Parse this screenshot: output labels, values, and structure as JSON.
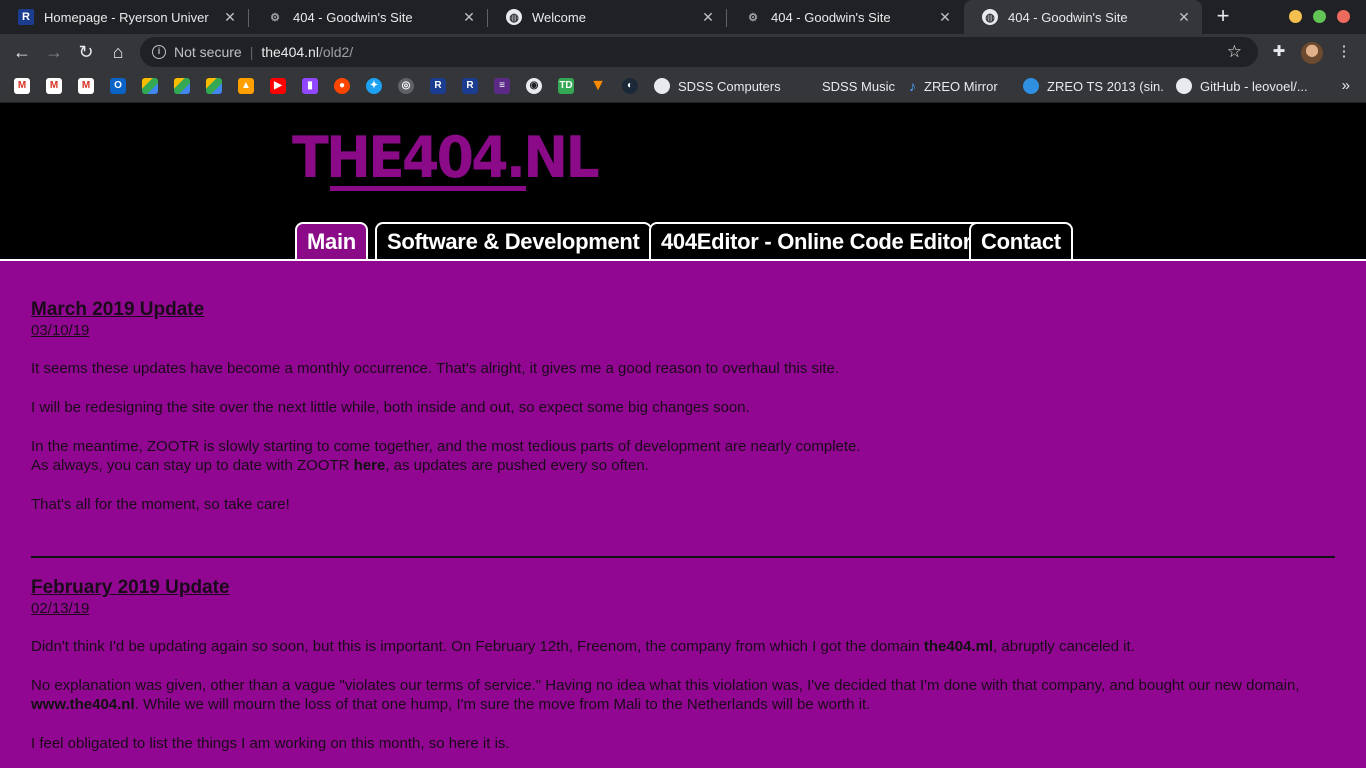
{
  "browser": {
    "tabs": [
      {
        "title": "Homepage - Ryerson Univer",
        "active": false
      },
      {
        "title": "404 - Goodwin's Site",
        "active": false
      },
      {
        "title": "Welcome",
        "active": false
      },
      {
        "title": "404 - Goodwin's Site",
        "active": false
      },
      {
        "title": "404 - Goodwin's Site",
        "active": true
      }
    ],
    "new_tab": "+",
    "address": {
      "security_label": "Not secure",
      "host": "the404.nl",
      "path": "/old2/"
    },
    "bookmarks": [
      {
        "label": "SDSS Computers"
      },
      {
        "label": "SDSS Music"
      },
      {
        "label": "ZREO Mirror"
      },
      {
        "label": "ZREO TS 2013 (sin..."
      },
      {
        "label": "GitHub - leovoel/..."
      }
    ],
    "bookmark_more": "»",
    "colors": {
      "tab_strip": "#202124",
      "toolbar": "#35363a"
    }
  },
  "site": {
    "logo_text": "THE404.NL",
    "nav": [
      {
        "label": "Main",
        "active": true
      },
      {
        "label": "Software & Development",
        "active": false
      },
      {
        "label": "404Editor - Online Code Editor",
        "active": false
      },
      {
        "label": "Contact",
        "active": false
      }
    ],
    "colors": {
      "background": "#910791",
      "accent": "#8a0a88",
      "header": "#000000"
    }
  },
  "posts": [
    {
      "title": "March 2019 Update",
      "date": "03/10/19",
      "p1": "It seems these updates have become a monthly occurrence. That's alright, it gives me a good reason to overhaul this site.",
      "p2": "I will be redesigning the site over the next little while, both inside and out, so expect some big changes soon.",
      "p3_line1": "In the meantime, ZOOTR is slowly starting to come together, and the most tedious parts of development are nearly complete.",
      "p3_line2_pre": "As always, you can stay up to date with ZOOTR ",
      "p3_link": "here",
      "p3_line2_post": ", as updates are pushed every so often.",
      "p4": "That's all for the moment, so take care!"
    },
    {
      "title": "February 2019 Update",
      "date": "02/13/19",
      "p1_pre": "Didn't think I'd be updating again so soon, but this is important. On February 12th, Freenom, the company from which I got the domain ",
      "p1_bold": "the404.ml",
      "p1_post": ", abruptly canceled it.",
      "p2_pre": "No explanation was given, other than a vague \"violates our terms of service.\" Having no idea what this violation was, I've decided that I'm done with that company, and bought our new domain, ",
      "p2_bold": "www.the404.nl",
      "p2_post": ". While we will mourn the loss of that one hump, I'm sure the move from Mali to the Netherlands will be worth it.",
      "p3": "I feel obligated to list the things I am working on this month, so here it is."
    }
  ]
}
